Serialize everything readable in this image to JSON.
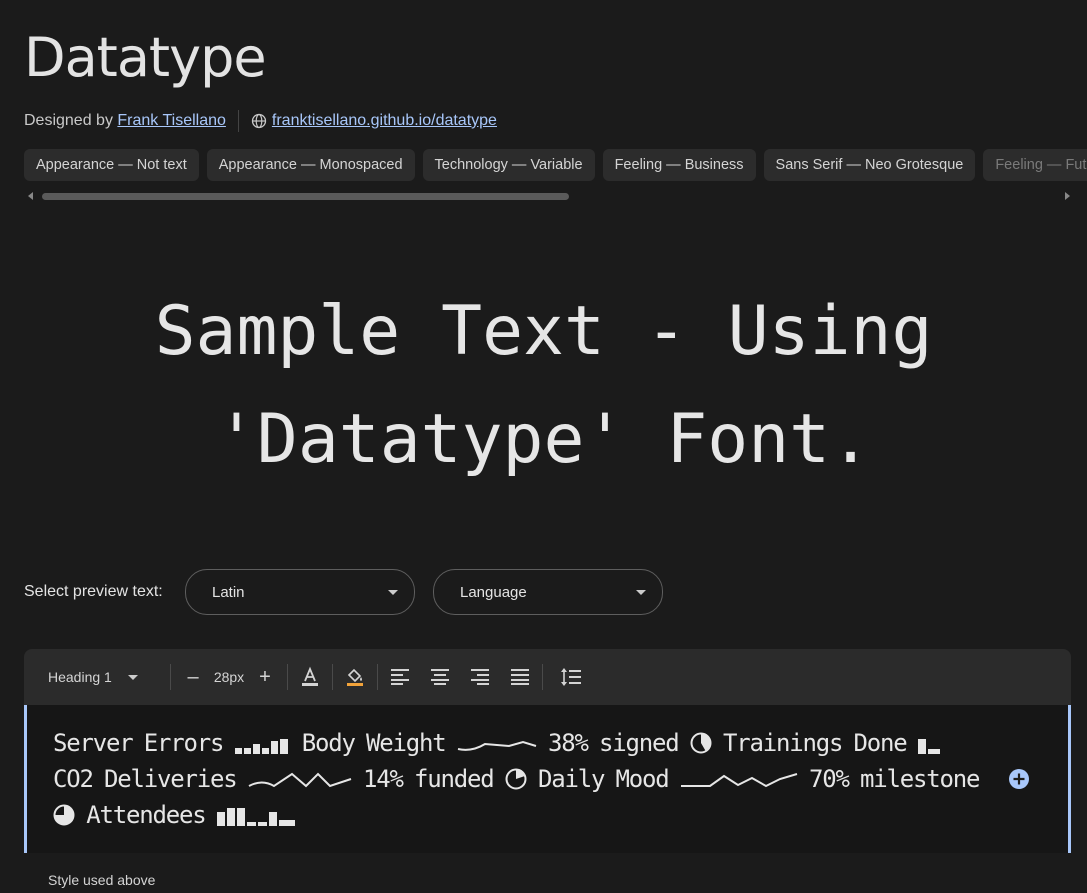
{
  "title": "Datatype",
  "designer": {
    "prefix": "Designed by",
    "name": "Frank Tisellano",
    "site_label": "franktisellano.github.io/datatype"
  },
  "tags": [
    "Appearance — Not text",
    "Appearance — Monospaced",
    "Technology — Variable",
    "Feeling — Business",
    "Sans Serif — Neo Grotesque",
    "Feeling — Futuristic"
  ],
  "sample": {
    "line1": "Sample Text - Using",
    "line2": "'Datatype' Font."
  },
  "preview": {
    "label": "Select preview text:",
    "script_value": "Latin",
    "language_value": "Language"
  },
  "toolbar": {
    "style": "Heading 1",
    "minus": "–",
    "size": "28px",
    "plus": "+"
  },
  "editor": {
    "w1": "Server Errors",
    "w2": "Body Weight",
    "w3": "38% signed",
    "w4": "Trainings Done",
    "w5": "CO2 Deliveries",
    "w6": "14% funded",
    "w7": "Daily Mood",
    "w8": "70% milestone",
    "w9": "Attendees"
  },
  "caption": "Style used above",
  "colors": {
    "background": "#1b1b1b",
    "link": "#a8c7fa",
    "accent": "#a8c7fa"
  }
}
